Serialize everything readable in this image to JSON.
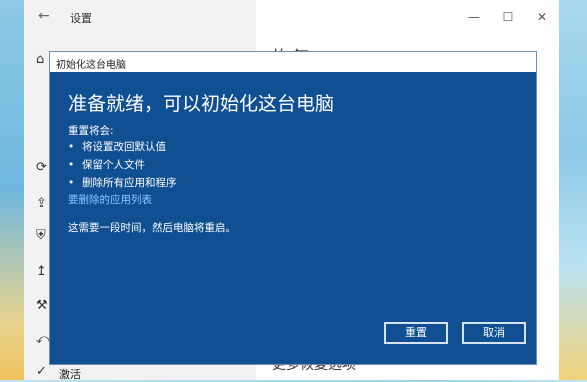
{
  "settings": {
    "title": "设置",
    "back_icon": "back-arrow-icon",
    "controls": [
      "—",
      "☐",
      "✕"
    ],
    "sidebar_last_label": "激活",
    "right_heading": "恢复",
    "right_bottom": "更多恢复选项"
  },
  "dialog": {
    "title": "初始化这台电脑",
    "heading": "准备就绪，可以初始化这台电脑",
    "subheading": "重置将会:",
    "items": [
      "将设置改回默认值",
      "保留个人文件",
      "删除所有应用和程序"
    ],
    "link": "要删除的应用列表",
    "note": "这需要一段时间，然后电脑将重启。",
    "reset_label": "重置",
    "cancel_label": "取消"
  }
}
